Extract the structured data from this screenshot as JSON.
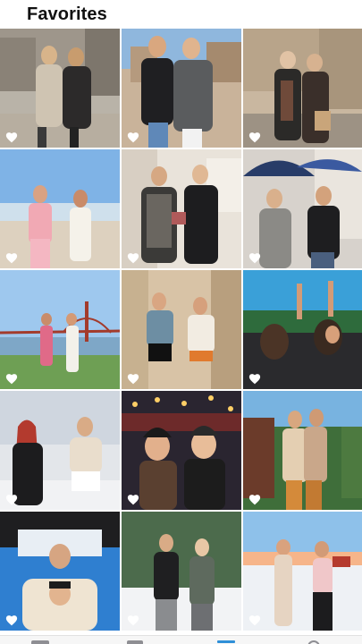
{
  "header": {
    "title": "Favorites"
  },
  "grid": {
    "tiles": [
      {
        "id": "t1",
        "favorite": true
      },
      {
        "id": "t2",
        "favorite": true
      },
      {
        "id": "t3",
        "favorite": true
      },
      {
        "id": "t4",
        "favorite": true
      },
      {
        "id": "t5",
        "favorite": true
      },
      {
        "id": "t6",
        "favorite": true
      },
      {
        "id": "t7",
        "favorite": true
      },
      {
        "id": "t8",
        "favorite": true
      },
      {
        "id": "t9",
        "favorite": true
      },
      {
        "id": "t10",
        "favorite": true
      },
      {
        "id": "t11",
        "favorite": true
      },
      {
        "id": "t12",
        "favorite": true
      },
      {
        "id": "t13",
        "favorite": true
      },
      {
        "id": "t14",
        "favorite": true
      },
      {
        "id": "t15",
        "favorite": true
      }
    ]
  },
  "tabbar": {
    "icons": [
      "library-icon",
      "for-you-icon",
      "albums-icon",
      "search-icon"
    ],
    "active": "albums-icon"
  },
  "colors": {
    "heart": "#ffffff",
    "accent": "#2f8fd8"
  }
}
